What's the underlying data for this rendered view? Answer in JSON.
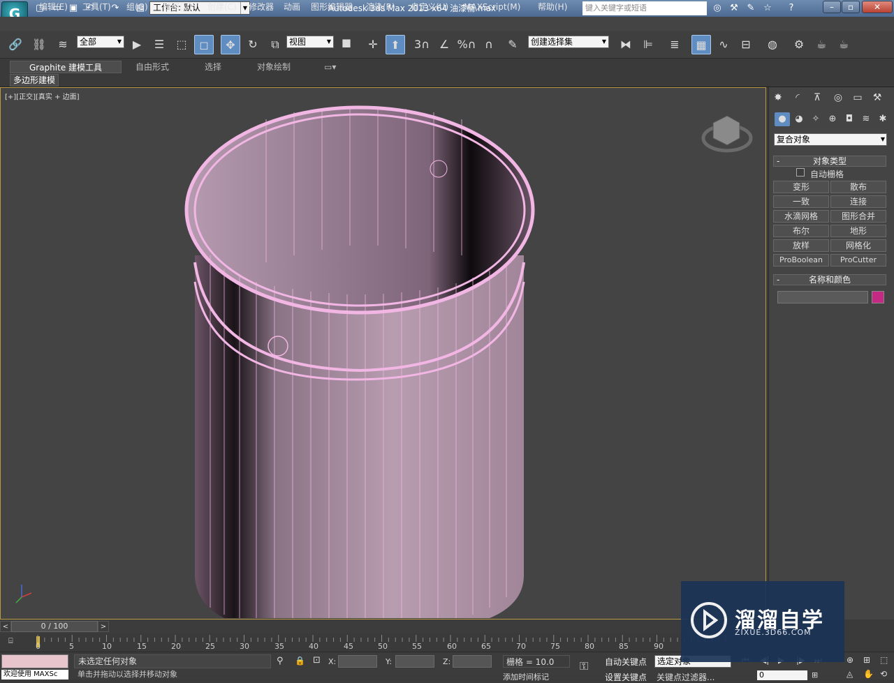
{
  "title_bar": {
    "logo": "G",
    "workspace": "工作台: 默认",
    "app_title": "Autodesk 3ds Max  2013 x64      油漆桶.max",
    "search_placeholder": "键入关键字或短语"
  },
  "menu": [
    "编辑(E)",
    "工具(T)",
    "组(G)",
    "视图(V)",
    "创建(C)",
    "修改器",
    "动画",
    "图形编辑器",
    "渲染(R)",
    "自定义(U)",
    "MAXScript(M)",
    "帮助(H)"
  ],
  "toolbar": {
    "selection_filter": "全部",
    "ref_coord": "视图",
    "named_selection": "创建选择集",
    "snap_3": "3",
    "angle_snap": "%"
  },
  "ribbon": {
    "tabs": [
      "Graphite 建模工具",
      "自由形式",
      "选择",
      "对象绘制"
    ],
    "sub_tab": "多边形建模"
  },
  "viewport": {
    "label": "[+][正交][真实 + 边面]"
  },
  "command_panel": {
    "category": "复合对象",
    "object_type_title": "对象类型",
    "autogrid": "自动栅格",
    "buttons": [
      "变形",
      "散布",
      "一致",
      "连接",
      "水滴网格",
      "图形合并",
      "布尔",
      "地形",
      "放样",
      "网格化",
      "ProBoolean",
      "ProCutter"
    ],
    "name_color_title": "名称和颜色",
    "object_color": "#c42a84"
  },
  "timeline": {
    "slider_text": "0 / 100",
    "ticks": [
      "0",
      "5",
      "10",
      "15",
      "20",
      "25",
      "30",
      "35",
      "40",
      "45",
      "50",
      "55",
      "60",
      "65",
      "70",
      "75",
      "80",
      "85",
      "90"
    ]
  },
  "status": {
    "maxscript": "欢迎使用 MAXSc",
    "message": "未选定任何对象",
    "prompt": "单击并拖动以选择并移动对象",
    "x_label": "X:",
    "y_label": "Y:",
    "z_label": "Z:",
    "grid": "栅格 = 10.0",
    "auto_key": "自动关键点",
    "set_key": "设置关键点",
    "selected": "选定对象",
    "key_filter": "关键点过滤器...",
    "add_time_tag": "添加时间标记",
    "frame": "0"
  },
  "watermark": {
    "brand": "溜溜自学",
    "url": "ZIXUE.3D66.COM"
  }
}
